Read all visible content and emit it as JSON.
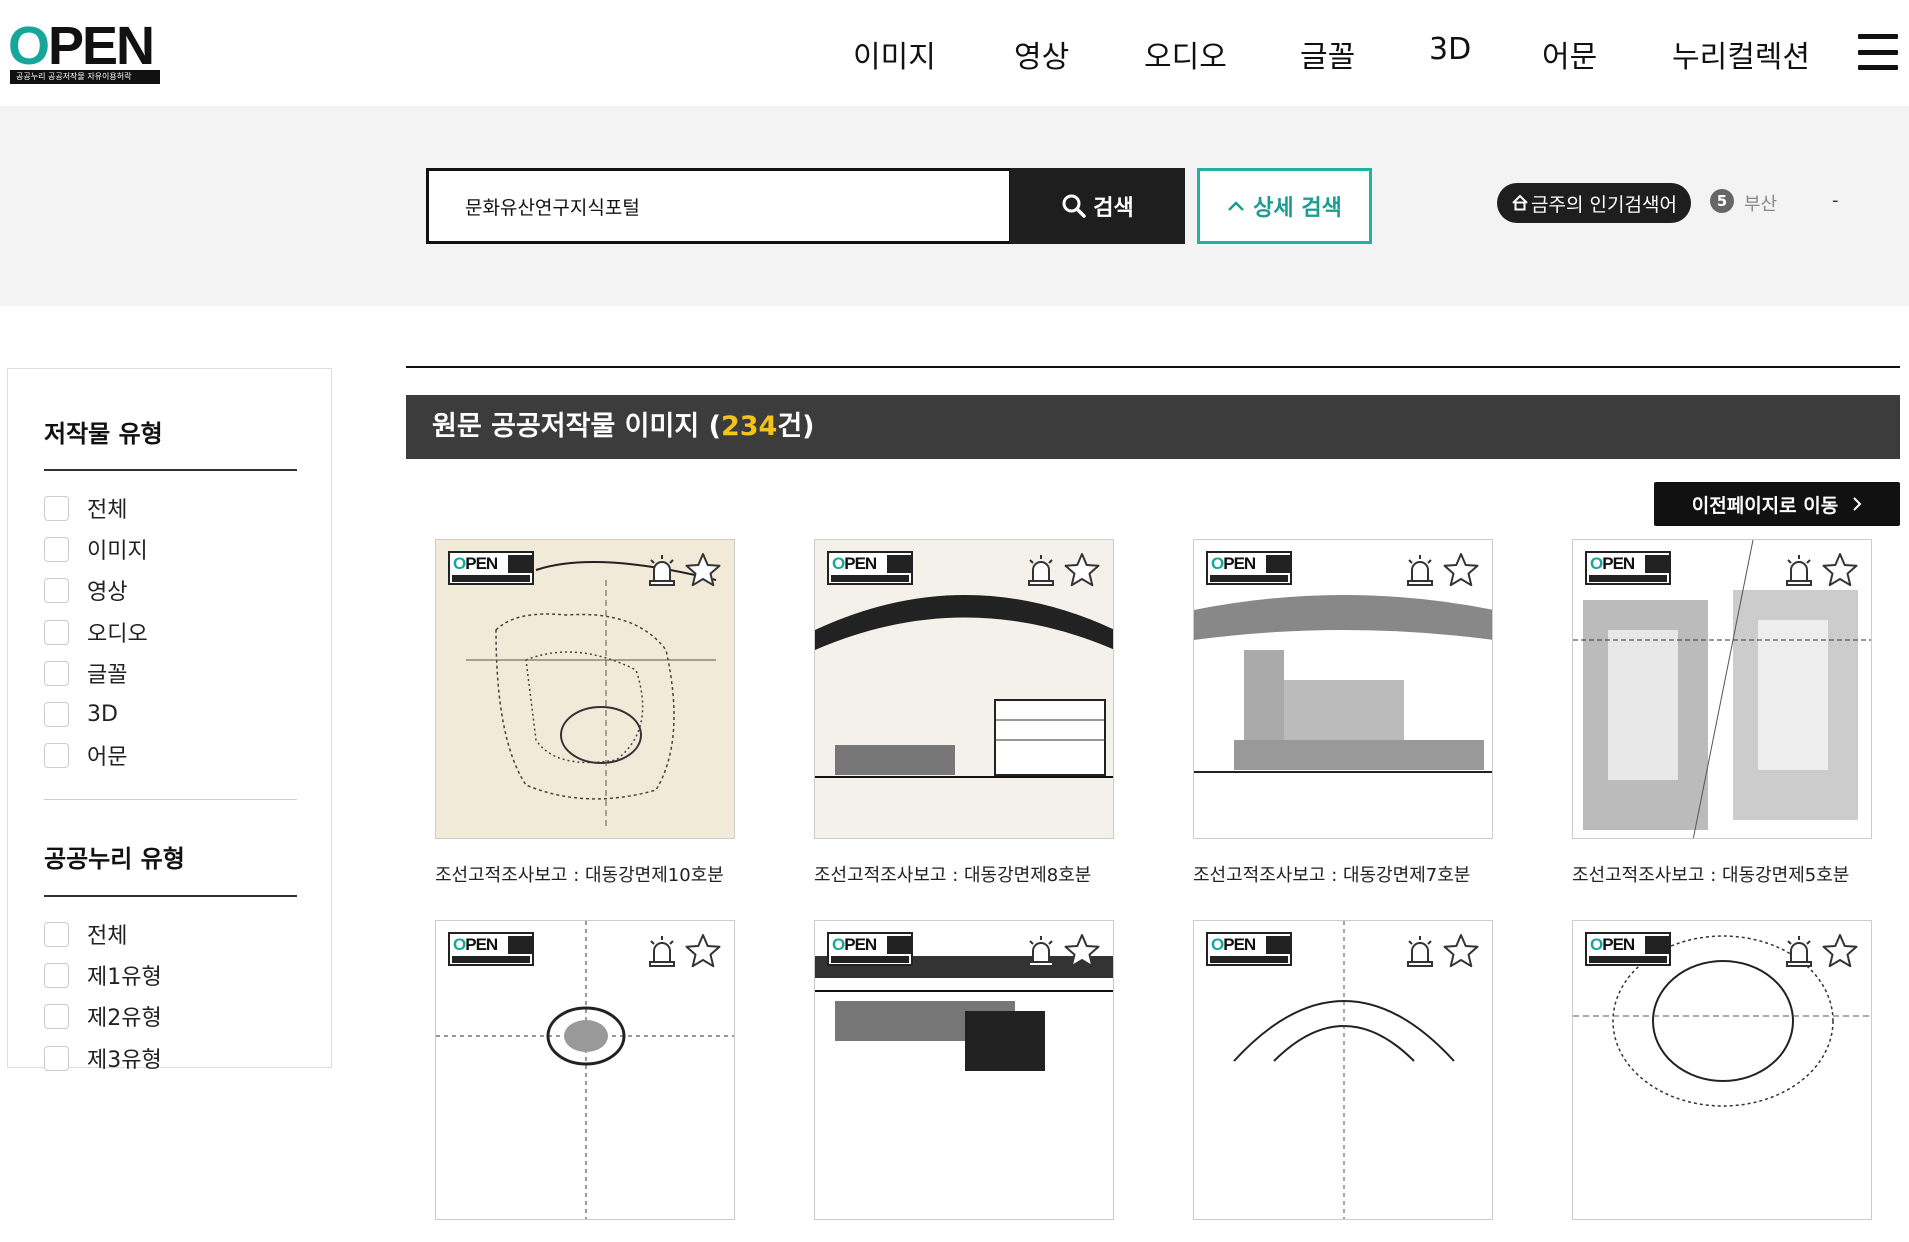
{
  "header": {
    "logo_word": "PEN",
    "logo_tagline": "공공누리  공공저작물 자유이용허락",
    "nav": [
      "이미지",
      "영상",
      "오디오",
      "글꼴",
      "3D",
      "어문",
      "누리컬렉션"
    ]
  },
  "search": {
    "value": "문화유산연구지식포털",
    "button_label": "검색",
    "detail_label": "상세 검색",
    "popular_label": "금주의 인기검색어",
    "popular_rank": "5",
    "popular_word": "부산",
    "popular_change": "-"
  },
  "sidebar": {
    "type_title": "저작물 유형",
    "type_options": [
      "전체",
      "이미지",
      "영상",
      "오디오",
      "글꼴",
      "3D",
      "어문"
    ],
    "nuri_title": "공공누리 유형",
    "nuri_options": [
      "전체",
      "제1유형",
      "제2유형",
      "제3유형"
    ]
  },
  "results": {
    "heading_prefix": "원문 공공저작물 이미지 (",
    "count": "234",
    "heading_suffix": "건)",
    "prev_page_label": "이전페이지로 이동",
    "items": [
      {
        "title": "조선고적조사보고 : 대동강면제10호분"
      },
      {
        "title": "조선고적조사보고 : 대동강면제8호분"
      },
      {
        "title": "조선고적조사보고 : 대동강면제7호분"
      },
      {
        "title": "조선고적조사보고 : 대동강면제5호분"
      },
      {
        "title": ""
      },
      {
        "title": ""
      },
      {
        "title": ""
      },
      {
        "title": ""
      }
    ]
  },
  "colors": {
    "accent": "#1fb3a3",
    "count_highlight": "#f6c31c",
    "dark": "#1e1e1e"
  }
}
